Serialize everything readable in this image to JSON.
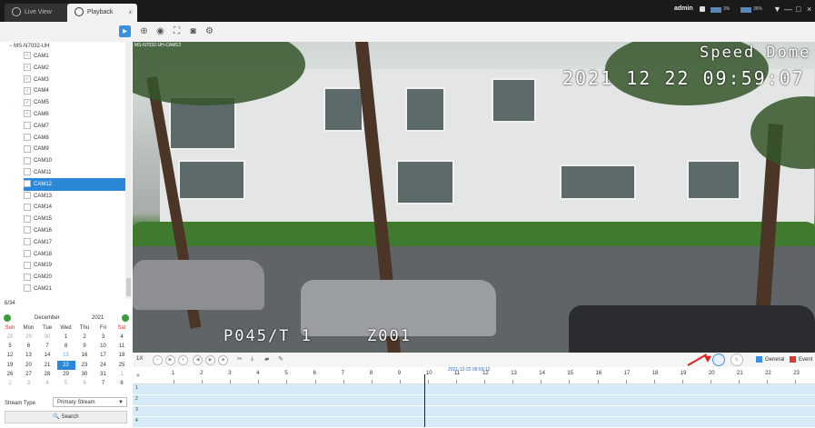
{
  "tabs": [
    {
      "label": "Live View",
      "close": "×"
    },
    {
      "label": "Playback",
      "close": "×"
    }
  ],
  "add_tab": "+",
  "user": "admin",
  "meters": [
    {
      "label": "3%"
    },
    {
      "label": "36%"
    }
  ],
  "window_controls": {
    "filter": "▼",
    "minimize": "—",
    "restore": "□",
    "close": "×"
  },
  "tree": {
    "root": "MS-N7032-UH",
    "count": "6/34",
    "selected": "CAM12",
    "cameras": [
      {
        "name": "CAM1",
        "checked": true
      },
      {
        "name": "CAM2",
        "checked": true
      },
      {
        "name": "CAM3",
        "checked": true
      },
      {
        "name": "CAM4",
        "checked": true
      },
      {
        "name": "CAM5",
        "checked": true
      },
      {
        "name": "CAM6",
        "checked": true
      },
      {
        "name": "CAM7",
        "checked": false
      },
      {
        "name": "CAM8",
        "checked": false
      },
      {
        "name": "CAM9",
        "checked": false
      },
      {
        "name": "CAM10",
        "checked": false
      },
      {
        "name": "CAM11",
        "checked": false
      },
      {
        "name": "CAM12",
        "checked": false
      },
      {
        "name": "CAM13",
        "checked": false
      },
      {
        "name": "CAM14",
        "checked": false
      },
      {
        "name": "CAM15",
        "checked": false
      },
      {
        "name": "CAM16",
        "checked": false
      },
      {
        "name": "CAM17",
        "checked": false
      },
      {
        "name": "CAM18",
        "checked": false
      },
      {
        "name": "CAM19",
        "checked": false
      },
      {
        "name": "CAM20",
        "checked": false
      },
      {
        "name": "CAM21",
        "checked": false
      }
    ]
  },
  "calendar": {
    "month": "December",
    "year": "2021",
    "weekdays": [
      "Sun",
      "Mon",
      "Tue",
      "Wed",
      "Thu",
      "Fri",
      "Sat"
    ],
    "weeks": [
      [
        "28",
        "29",
        "30",
        "1",
        "2",
        "3",
        "4"
      ],
      [
        "5",
        "6",
        "7",
        "8",
        "9",
        "10",
        "11"
      ],
      [
        "12",
        "13",
        "14",
        "15",
        "16",
        "17",
        "18"
      ],
      [
        "19",
        "20",
        "21",
        "22",
        "23",
        "24",
        "25"
      ],
      [
        "26",
        "27",
        "28",
        "29",
        "30",
        "31",
        "1"
      ],
      [
        "2",
        "3",
        "4",
        "5",
        "6",
        "7",
        "8"
      ]
    ],
    "selected_day": "22"
  },
  "stream_type": {
    "label": "Stream Type",
    "value": "Primary Stream"
  },
  "search_button": "Search",
  "video": {
    "camera_label": "MS-N7032-UH-CAM12",
    "title_overlay": "Speed Dome",
    "timestamp_overlay": "2021 12 22 09:59:07",
    "bottom_overlay_left": "P045/T 1",
    "bottom_overlay_right": "Z001"
  },
  "playback": {
    "speed": "1X",
    "legend": [
      {
        "label": "General",
        "color": "#3b8fe0"
      },
      {
        "label": "Event",
        "color": "#e03a2f"
      }
    ]
  },
  "timeline": {
    "current_time": "2021-12-22 09:59:12",
    "hours": [
      "1",
      "2",
      "3",
      "4",
      "5",
      "6",
      "7",
      "8",
      "9",
      "10",
      "11",
      "12",
      "13",
      "14",
      "15",
      "16",
      "17",
      "18",
      "19",
      "20",
      "21",
      "22",
      "23"
    ],
    "rows": [
      "1",
      "2",
      "3",
      "4"
    ]
  }
}
